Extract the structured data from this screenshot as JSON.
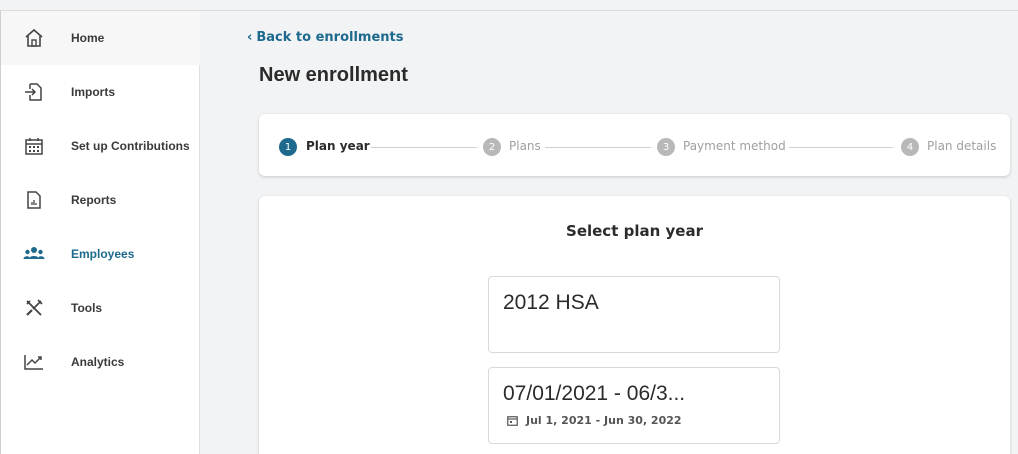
{
  "sidebar": {
    "items": [
      {
        "label": "Home",
        "icon": "home-icon"
      },
      {
        "label": "Imports",
        "icon": "import-icon"
      },
      {
        "label": "Set up Contributions",
        "icon": "calendar-grid-icon"
      },
      {
        "label": "Reports",
        "icon": "report-icon"
      },
      {
        "label": "Employees",
        "icon": "people-icon",
        "active": true
      },
      {
        "label": "Tools",
        "icon": "tools-icon"
      },
      {
        "label": "Analytics",
        "icon": "trend-icon"
      }
    ]
  },
  "main": {
    "back_link": "Back to enrollments",
    "title": "New enrollment",
    "steps": [
      {
        "number": "1",
        "label": "Plan year",
        "active": true
      },
      {
        "number": "2",
        "label": "Plans"
      },
      {
        "number": "3",
        "label": "Payment method"
      },
      {
        "number": "4",
        "label": "Plan details"
      }
    ],
    "card_title": "Select plan year",
    "options": [
      {
        "name": "2012 HSA",
        "dates": ""
      },
      {
        "name": "07/01/2021 - 06/3...",
        "dates": "Jul 1, 2021 - Jun 30, 2022"
      }
    ]
  },
  "colors": {
    "accent": "#1e6a8e",
    "inactive_step": "#b8b8b8"
  }
}
